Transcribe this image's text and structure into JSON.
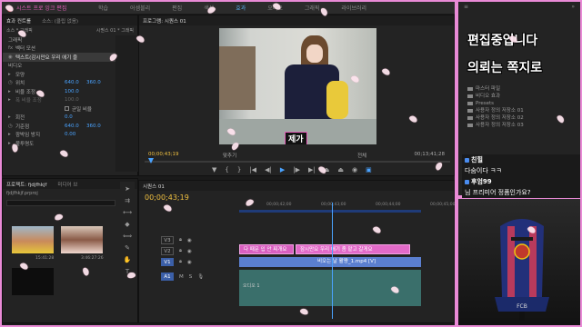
{
  "menubar": {
    "app_title": "시스트 프로 잉크 편집",
    "menus": [
      "학습",
      "어셈블리",
      "편집",
      "색상",
      "효과",
      "오디오",
      "그래픽",
      "라이브러리"
    ],
    "active_menu": "효과"
  },
  "effect_controls": {
    "tabs": [
      "효과 컨트롤",
      "소스: (클립 없음)"
    ],
    "source_label": "소스 * 그래픽",
    "sequence_label": "시퀀스 01 * 그래픽",
    "section_graphic": "그래픽",
    "motion": "벡터 모션",
    "text_layer": "텍스트(감시만요 우리 애기 즐",
    "section_video": "비디오",
    "rows": [
      {
        "label": "모양",
        "v1": "",
        "v2": ""
      },
      {
        "label": "위치",
        "v1": "640.0",
        "v2": "360.0"
      },
      {
        "label": "비율 조정",
        "v1": "100.0",
        "v2": ""
      },
      {
        "label": "폭 비율 조정",
        "v1": "100.0",
        "v2": ""
      },
      {
        "label": "",
        "v1": "",
        "v2": "균일 비율"
      },
      {
        "label": "회전",
        "v1": "0.0",
        "v2": ""
      },
      {
        "label": "기준점",
        "v1": "640.0",
        "v2": "360.0"
      },
      {
        "label": "깜박임 방지",
        "v1": "0.00",
        "v2": ""
      },
      {
        "label": "불투명도",
        "v1": "",
        "v2": ""
      }
    ]
  },
  "project": {
    "tabs": [
      "프로젝트: fjdjfhkjf",
      "미디어 브"
    ],
    "file": "fjdjfhkjf.prproj",
    "items": [
      {
        "name": "",
        "duration": "15:41:28"
      },
      {
        "name": "",
        "duration": "3:46:27:26"
      }
    ]
  },
  "program_monitor": {
    "tab": "프로그램: 시퀀스 01",
    "timecode": "00;00;43;19",
    "fit": "맞추기",
    "quality": "전체",
    "duration": "00;13;41;28",
    "subtitle": "제가"
  },
  "timeline": {
    "tab": "시퀀스 01",
    "timecode": "00;00;43;19",
    "ruler": [
      "00;00;42;00",
      "00;00;43;00",
      "00;00;44;00",
      "00;00;45;00"
    ],
    "tracks": [
      "V3",
      "V2",
      "V1",
      "A1"
    ],
    "clips": {
      "v2a": "다 때문 입 안 찌개요",
      "v2b": "잠시만요 우리 애기 좀 맡고 갈게요",
      "v1": "비오는 날 활쨩_1.mp4 [V]",
      "a1_label": "오디오 1"
    }
  },
  "chat": {
    "overlay_line1": "편집중입니다",
    "overlay_line2": "의뢰는 쪽지로",
    "tree": [
      "마스터 파일",
      "비디오 효과",
      "Presets",
      "사용자 정의 저장소 01",
      "사용자 정의 저장소 02",
      "사용자 정의 저장소 03"
    ],
    "messages": [
      {
        "user": "친힐",
        "text": "다숨이다 ㅋㅋ"
      },
      {
        "user": "후엄99",
        "text": "님 프리미어 정품인가요?"
      }
    ]
  },
  "colors": {
    "frame_border": "#e98ad6",
    "accent_blue": "#4aa3ff",
    "timecode_yellow": "#f0c040",
    "clip_pink": "#d95fc0"
  }
}
